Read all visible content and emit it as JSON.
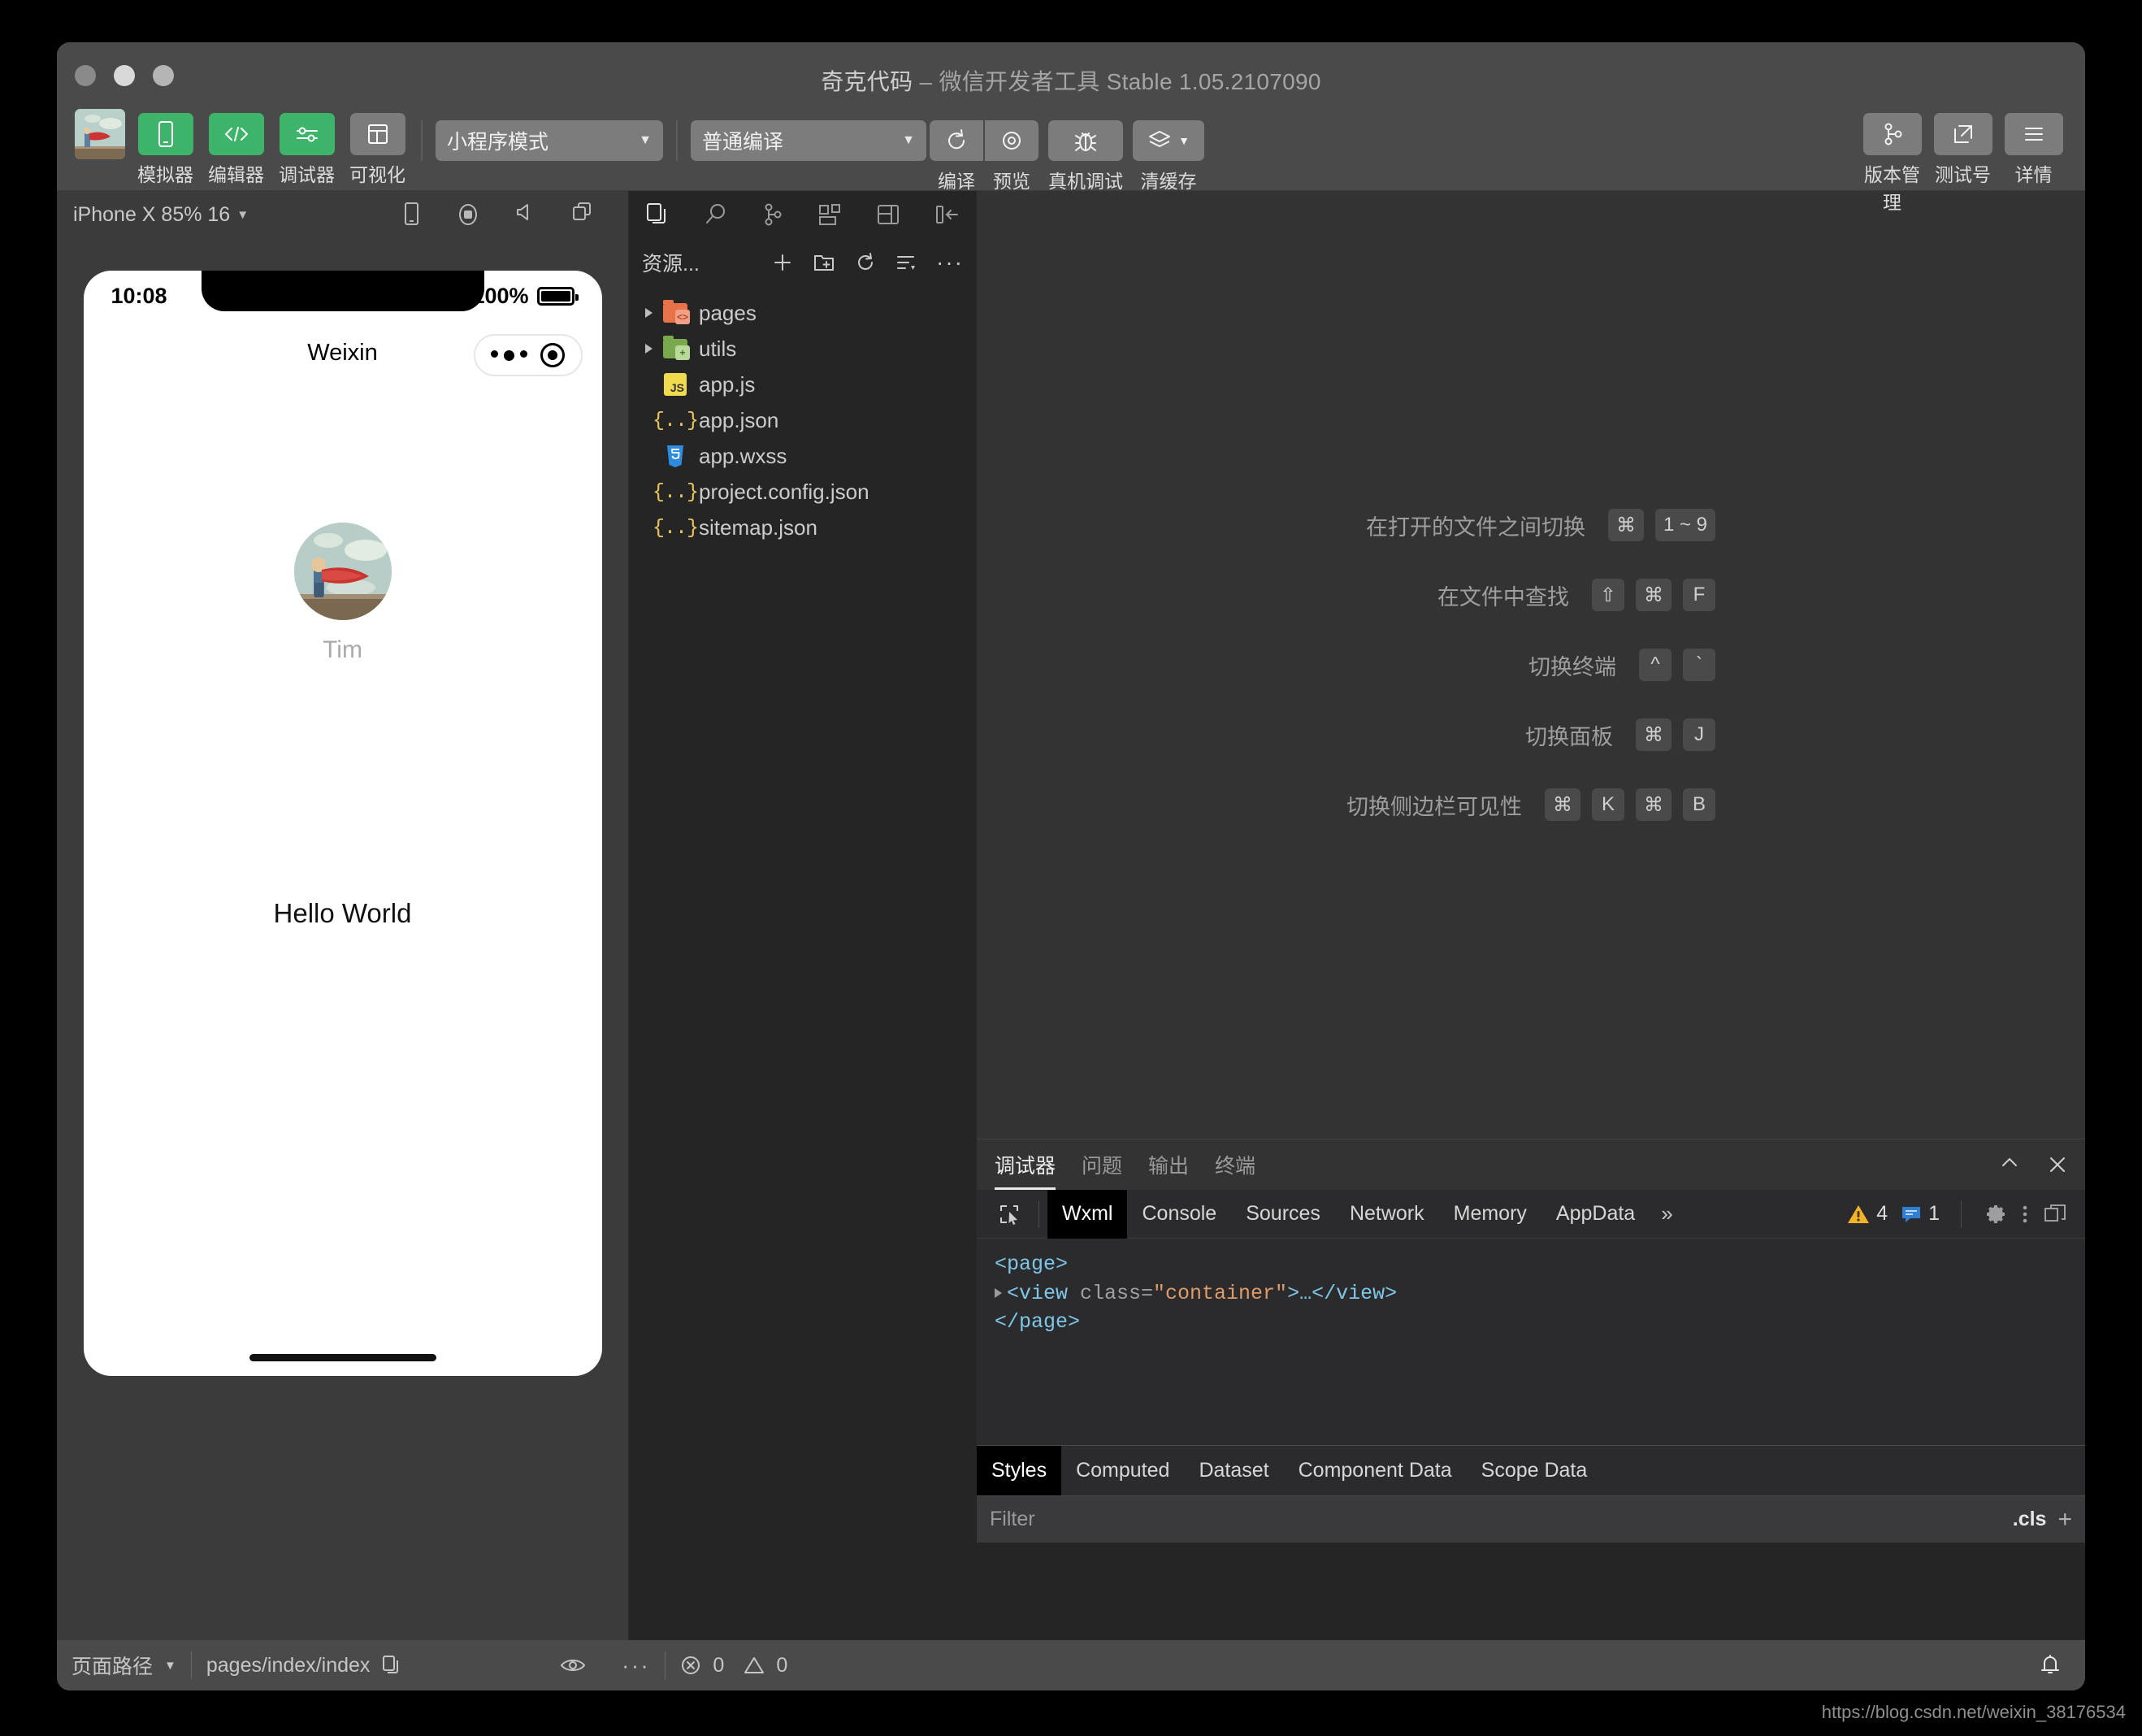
{
  "window": {
    "title_project": "奇克代码",
    "title_sep": " – ",
    "title_app": "微信开发者工具 Stable 1.05.2107090"
  },
  "toolbar": {
    "items": [
      {
        "label": "模拟器",
        "icon": "phone-icon",
        "style": "green"
      },
      {
        "label": "编辑器",
        "icon": "code-icon",
        "style": "green"
      },
      {
        "label": "调试器",
        "icon": "sliders-icon",
        "style": "green"
      },
      {
        "label": "可视化",
        "icon": "layout-icon",
        "style": "grey"
      }
    ],
    "mode_select": "小程序模式",
    "build_select": "普通编译",
    "actions": [
      {
        "label": "编译",
        "icon": "refresh-icon"
      },
      {
        "label": "预览",
        "icon": "eye-icon"
      },
      {
        "label": "真机调试",
        "icon": "bug-icon"
      },
      {
        "label": "清缓存",
        "icon": "layers-icon"
      }
    ],
    "right_items": [
      {
        "label": "版本管理",
        "icon": "branch-icon"
      },
      {
        "label": "测试号",
        "icon": "external-link-icon"
      },
      {
        "label": "详情",
        "icon": "menu-icon"
      }
    ]
  },
  "simulator": {
    "device_label": "iPhone X 85% 16",
    "icons": [
      "phone-rotate-icon",
      "record-icon",
      "volume-icon",
      "window-icon"
    ],
    "phone": {
      "time": "10:08",
      "battery_percent": "100%",
      "nav_title": "Weixin",
      "user_name": "Tim",
      "hello_text": "Hello World"
    }
  },
  "explorer": {
    "activity_icons": [
      "files-icon",
      "search-icon",
      "branch-icon",
      "extensions-icon",
      "layout-split-icon",
      "collapse-sidebar-icon"
    ],
    "header_title": "资源...",
    "header_icons": [
      "plus-icon",
      "new-folder-icon",
      "refresh-icon",
      "collapse-all-icon",
      "more-icon"
    ],
    "tree": [
      {
        "name": "pages",
        "type": "folder",
        "color": "orange",
        "expandable": true
      },
      {
        "name": "utils",
        "type": "folder",
        "color": "green",
        "expandable": true
      },
      {
        "name": "app.js",
        "type": "js",
        "expandable": false
      },
      {
        "name": "app.json",
        "type": "json",
        "expandable": false
      },
      {
        "name": "app.wxss",
        "type": "wxss",
        "expandable": false
      },
      {
        "name": "project.config.json",
        "type": "json",
        "expandable": false
      },
      {
        "name": "sitemap.json",
        "type": "json",
        "expandable": false
      }
    ]
  },
  "editor": {
    "shortcuts": [
      {
        "label": "在打开的文件之间切换",
        "keys": [
          "⌘",
          "1 ~ 9"
        ]
      },
      {
        "label": "在文件中查找",
        "keys": [
          "⇧",
          "⌘",
          "F"
        ]
      },
      {
        "label": "切换终端",
        "keys": [
          "^",
          "`"
        ]
      },
      {
        "label": "切换面板",
        "keys": [
          "⌘",
          "J"
        ]
      },
      {
        "label": "切换侧边栏可见性",
        "keys": [
          "⌘",
          "K",
          "⌘",
          "B"
        ]
      }
    ]
  },
  "debugger": {
    "panel_tabs": [
      {
        "label": "调试器",
        "active": true
      },
      {
        "label": "问题",
        "active": false
      },
      {
        "label": "输出",
        "active": false
      },
      {
        "label": "终端",
        "active": false
      }
    ],
    "panel_actions": [
      "collapse-icon",
      "close-icon"
    ],
    "devtools_tabs": [
      {
        "label": "Wxml",
        "active": true
      },
      {
        "label": "Console",
        "active": false
      },
      {
        "label": "Sources",
        "active": false
      },
      {
        "label": "Network",
        "active": false
      },
      {
        "label": "Memory",
        "active": false
      },
      {
        "label": "AppData",
        "active": false
      }
    ],
    "overflow_label": "»",
    "warning_count": "4",
    "message_count": "1",
    "right_icons": [
      "gear-icon",
      "kebab-icon",
      "dock-icon"
    ],
    "wxml": {
      "line1": "<page>",
      "line2_a": "<view ",
      "line2_b": "class=",
      "line2_c": "\"container\"",
      "line2_d": ">…</view>",
      "line3": "</page>"
    },
    "styles_tabs": [
      {
        "label": "Styles",
        "active": true
      },
      {
        "label": "Computed",
        "active": false
      },
      {
        "label": "Dataset",
        "active": false
      },
      {
        "label": "Component Data",
        "active": false
      },
      {
        "label": "Scope Data",
        "active": false
      }
    ],
    "filter_placeholder": "Filter",
    "cls_label": ".cls"
  },
  "status_bar": {
    "page_path_label": "页面路径",
    "page_path_value": "pages/index/index",
    "copy_icon": "copy-icon",
    "eye_icon": "eye-icon",
    "more_icon": "more-icon",
    "error_count": "0",
    "warning_count": "0",
    "bell_icon": "bell-icon"
  },
  "watermark": "https://blog.csdn.net/weixin_38176534",
  "colors": {
    "accent_green": "#3eb36a",
    "window_chrome": "#4a4a4a",
    "panel_bg": "#252526",
    "editor_bg": "#333333",
    "warning_yellow": "#f0b429",
    "message_blue": "#4a90e2"
  }
}
